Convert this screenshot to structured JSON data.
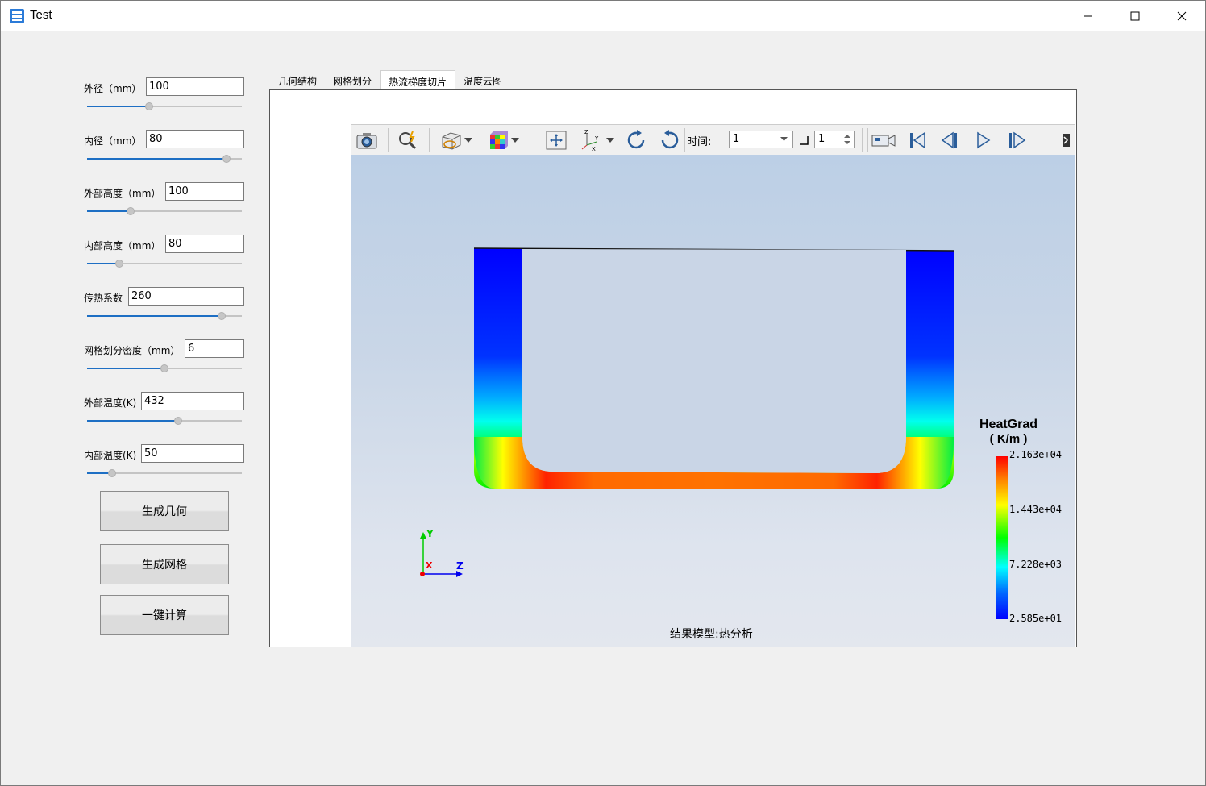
{
  "window": {
    "title": "Test"
  },
  "params": [
    {
      "label": "外径（mm）",
      "value": "100",
      "level": 0.4
    },
    {
      "label": "内径（mm）",
      "value": "80",
      "level": 0.9
    },
    {
      "label": "外部高度（mm）",
      "value": "100",
      "level": 0.28
    },
    {
      "label": "内部高度（mm）",
      "value": "80",
      "level": 0.21
    },
    {
      "label": "传热系数",
      "value": "260",
      "level": 0.87
    },
    {
      "label": "网格划分密度（mm）",
      "value": "6",
      "level": 0.5
    },
    {
      "label": "外部温度(K)",
      "value": "432",
      "level": 0.59
    },
    {
      "label": "内部温度(K)",
      "value": "50",
      "level": 0.16
    }
  ],
  "buttons": {
    "gen_geometry": "生成几何",
    "gen_mesh": "生成网格",
    "compute": "一键计算"
  },
  "tabs": [
    {
      "label": "几何结构",
      "active": false
    },
    {
      "label": "网格划分",
      "active": false
    },
    {
      "label": "热流梯度切片",
      "active": true
    },
    {
      "label": "温度云图",
      "active": false
    }
  ],
  "toolbar": {
    "time_label": "时间:",
    "time_value": "1",
    "step_value": "1",
    "icons": [
      "camera-icon",
      "probe-icon",
      "display-mode-icon",
      "color-map-icon",
      "fit-view-icon",
      "axes-icon",
      "rotate-cw-icon",
      "rotate-ccw-icon",
      "record-icon",
      "first-frame-icon",
      "prev-frame-icon",
      "play-icon",
      "next-frame-icon"
    ]
  },
  "viewer": {
    "caption": "结果模型:热分析",
    "axes": {
      "y": "Y",
      "x": "X",
      "z": "Z"
    },
    "legend": {
      "title": "HeatGrad",
      "unit": "( K/m )",
      "ticks": [
        "2.163e+04",
        "1.443e+04",
        "7.228e+03",
        "2.585e+01"
      ],
      "colors": [
        "#ff0000",
        "#ffff00",
        "#00ff00",
        "#00ffff",
        "#0000ff"
      ]
    }
  }
}
